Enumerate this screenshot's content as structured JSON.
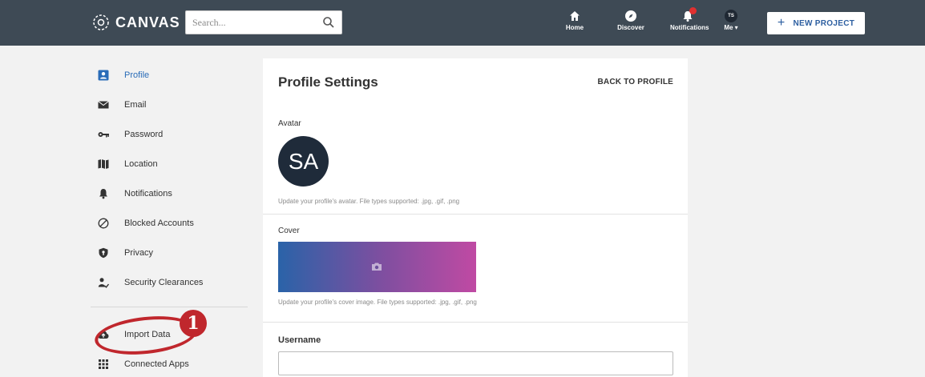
{
  "header": {
    "brand": "CANVAS",
    "search": {
      "placeholder": "Search..."
    },
    "nav": [
      {
        "label": "Home",
        "icon": "home-icon"
      },
      {
        "label": "Discover",
        "icon": "compass-icon"
      },
      {
        "label": "Notifications",
        "icon": "bell-icon"
      },
      {
        "label": "Me",
        "icon": "avatar",
        "initials": "TS"
      }
    ],
    "new_project_label": "NEW PROJECT"
  },
  "sidebar": {
    "items": [
      {
        "label": "Profile",
        "icon": "profile-icon",
        "active": true
      },
      {
        "label": "Email",
        "icon": "envelope-icon"
      },
      {
        "label": "Password",
        "icon": "key-icon"
      },
      {
        "label": "Location",
        "icon": "map-icon"
      },
      {
        "label": "Notifications",
        "icon": "bell-icon"
      },
      {
        "label": "Blocked Accounts",
        "icon": "blocked-icon"
      },
      {
        "label": "Privacy",
        "icon": "shield-icon"
      },
      {
        "label": "Security Clearances",
        "icon": "user-clearance-icon"
      },
      {
        "label": "Import Data",
        "icon": "cloud-upload-icon"
      },
      {
        "label": "Connected Apps",
        "icon": "grid-icon"
      }
    ]
  },
  "annotation": {
    "number": "1"
  },
  "main": {
    "title": "Profile Settings",
    "back_link": "BACK TO PROFILE",
    "avatar": {
      "label": "Avatar",
      "initials": "SA",
      "help": "Update your profile's avatar. File types supported: .jpg, .gif, .png"
    },
    "cover": {
      "label": "Cover",
      "help": "Update your profile's cover image. File types supported: .jpg, .gif, .png"
    },
    "username": {
      "label": "Username",
      "value": ""
    }
  },
  "colors": {
    "topbar": "#3e4a55",
    "accent": "#2a6cb8",
    "annotation": "#c0272d",
    "notification_dot": "#e03030"
  }
}
